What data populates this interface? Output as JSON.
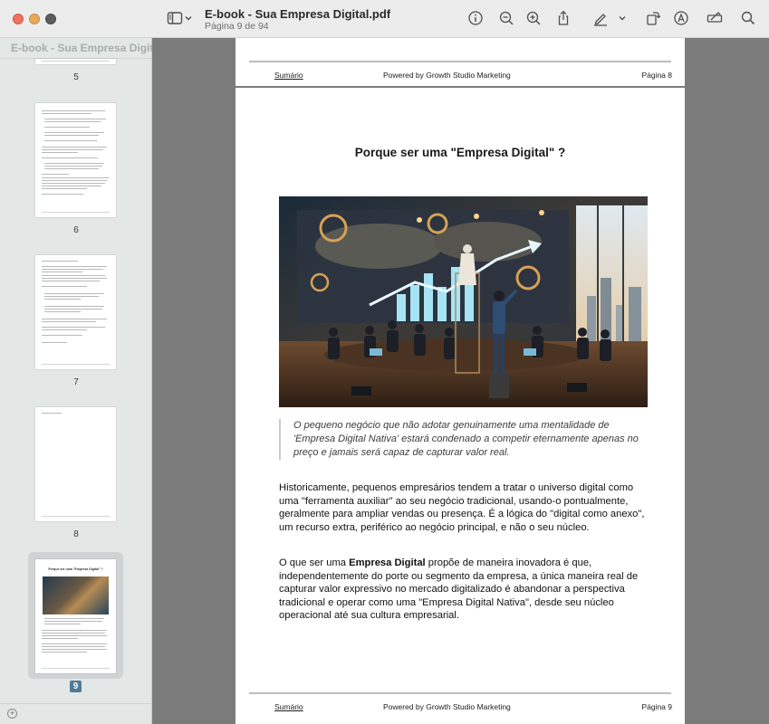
{
  "window": {
    "title": "E-book - Sua Empresa Digital.pdf",
    "subtitle": "Página 9 de 94"
  },
  "toolbar": {
    "icons": [
      "sidebar-icon",
      "chevron-down-icon",
      "info-icon",
      "zoom-out-icon",
      "zoom-in-icon",
      "share-icon",
      "highlight-icon",
      "chevron-down-icon",
      "rotate-icon",
      "markup-icon",
      "form-fill-icon",
      "search-icon"
    ]
  },
  "sidebar": {
    "title": "E-book - Sua Empresa Digital.pdf",
    "pages": [
      "5",
      "6",
      "7",
      "8",
      "9"
    ],
    "selected": "9",
    "thumb9_title": "Porque ser uma \"Empresa Digital\" ?"
  },
  "prev_page": {
    "footer_left": "Sumário",
    "footer_center": "Powered by Growth Studio Marketing",
    "footer_right": "Página 8"
  },
  "page": {
    "title": "Porque ser uma \"Empresa Digital\" ?",
    "quote": "O pequeno negócio que não adotar genuinamente uma mentalidade de 'Empresa Digital Nativa' estará condenado a competir eternamente apenas no preço e jamais será capaz de capturar valor real.",
    "para1": "Historicamente, pequenos empresários tendem a tratar o universo digital como uma \"ferramenta auxiliar\" ao seu negócio tradicional, usando-o pontualmente, geralmente para ampliar vendas ou presença. É a lógica do \"digital como anexo\", um recurso extra, periférico ao negócio principal, e não o seu núcleo.",
    "para2_pre": "O que ser uma ",
    "para2_bold": "Empresa Digital",
    "para2_post": " propõe de maneira inovadora é que, independentemente do porte ou segmento da empresa, a única maneira real de capturar valor expressivo no mercado digitalizado é abandonar a perspectiva tradicional e operar como uma \"Empresa Digital Nativa\", desde seu núcleo operacional até sua cultura empresarial.",
    "footer_left": "Sumário",
    "footer_center": "Powered by Growth Studio Marketing",
    "footer_right": "Página 9"
  },
  "colors": {
    "toolbar": "#ececec",
    "sidebar": "#e3e7e6",
    "canvas": "#7b7b7b",
    "badge": "#4f7a99"
  }
}
